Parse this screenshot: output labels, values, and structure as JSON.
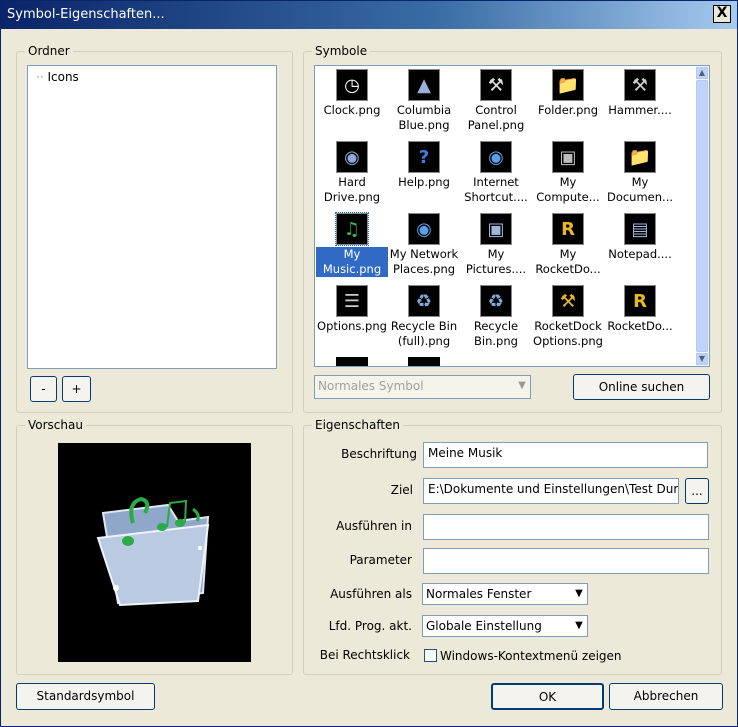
{
  "window": {
    "title": "Symbol-Eigenschaften...",
    "close_label": "X"
  },
  "ordner": {
    "legend": "Ordner",
    "tree_items": [
      "Icons"
    ],
    "minus_label": "-",
    "plus_label": "+"
  },
  "symbole": {
    "legend": "Symbole",
    "icons": [
      {
        "label": "Clock.png",
        "icon": "clock-icon"
      },
      {
        "label": "Columbia Blue.png",
        "icon": "shuttle-icon"
      },
      {
        "label": "Control Panel.png",
        "icon": "control-panel-icon"
      },
      {
        "label": "Folder.png",
        "icon": "folder-icon"
      },
      {
        "label": "Hammer....",
        "icon": "hammer-icon"
      },
      {
        "label": "Hard Drive.png",
        "icon": "hard-drive-icon"
      },
      {
        "label": "Help.png",
        "icon": "help-icon"
      },
      {
        "label": "Internet Shortcut....",
        "icon": "globe-icon"
      },
      {
        "label": "My Compute...",
        "icon": "computer-icon"
      },
      {
        "label": "My Documen...",
        "icon": "documents-icon"
      },
      {
        "label": "My Music.png",
        "icon": "music-folder-icon",
        "selected": true
      },
      {
        "label": "My Network Places.png",
        "icon": "network-icon"
      },
      {
        "label": "My Pictures....",
        "icon": "pictures-icon"
      },
      {
        "label": "My RocketDo...",
        "icon": "rocketdock-folder-icon"
      },
      {
        "label": "Notepad....",
        "icon": "notepad-icon"
      },
      {
        "label": "Options.png",
        "icon": "options-icon"
      },
      {
        "label": "Recycle Bin (full).png",
        "icon": "recycle-bin-full-icon"
      },
      {
        "label": "Recycle Bin.png",
        "icon": "recycle-bin-icon"
      },
      {
        "label": "RocketDock Options.png",
        "icon": "rocketdock-options-icon"
      },
      {
        "label": "RocketDo...",
        "icon": "rocketdock-icon"
      }
    ],
    "type_select": "Normales Symbol",
    "online_button": "Online suchen"
  },
  "vorschau": {
    "legend": "Vorschau",
    "icon": "music-folder-icon"
  },
  "eigenschaften": {
    "legend": "Eigenschaften",
    "beschriftung_label": "Beschriftung",
    "beschriftung_value": "Meine Musik",
    "ziel_label": "Ziel",
    "ziel_value": "E:\\Dokumente und Einstellungen\\Test Dum",
    "browse_label": "...",
    "ausfuehren_in_label": "Ausführen in",
    "ausfuehren_in_value": "",
    "parameter_label": "Parameter",
    "parameter_value": "",
    "ausfuehren_als_label": "Ausführen als",
    "ausfuehren_als_value": "Normales Fenster",
    "lfd_label": "Lfd. Prog. akt.",
    "lfd_value": "Globale Einstellung",
    "rechtsklick_label": "Bei Rechtsklick",
    "kontextmenu_label": "Windows-Kontextmenü zeigen"
  },
  "footer": {
    "standard_button": "Standardsymbol",
    "ok_button": "OK",
    "cancel_button": "Abbrechen"
  }
}
